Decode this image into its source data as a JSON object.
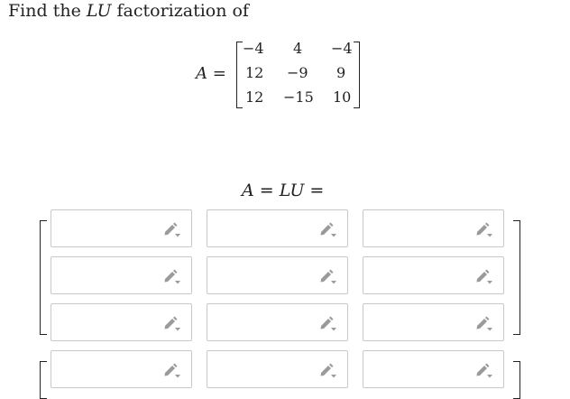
{
  "prompt": {
    "prefix": "Find the ",
    "emph": "LU",
    "suffix": " factorization of"
  },
  "matrix_a": {
    "lhs_var": "A",
    "lhs_eq": " = ",
    "rows": [
      [
        "−4",
        "4",
        "−4"
      ],
      [
        "12",
        "−9",
        "9"
      ],
      [
        "12",
        "−15",
        "10"
      ]
    ]
  },
  "lu_equation": {
    "a": "A",
    "eq1": " = ",
    "lu": "LU",
    "eq2": " ="
  },
  "inputs": {
    "rows": 4,
    "cols": 3,
    "values": [
      "",
      "",
      "",
      "",
      "",
      "",
      "",
      "",
      "",
      "",
      "",
      ""
    ],
    "icon": "pencil-edit-icon"
  },
  "colors": {
    "border": "#c8c8c8",
    "icon": "#9a9a9a",
    "text": "#222222"
  }
}
